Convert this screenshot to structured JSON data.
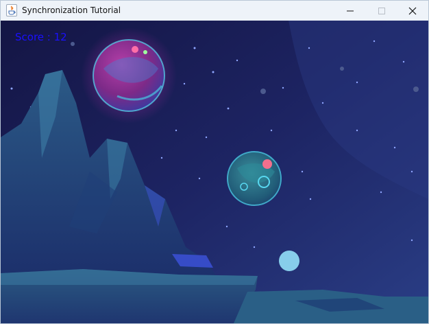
{
  "window": {
    "title": "Synchronization Tutorial",
    "controls": [
      "minimize-icon",
      "maximize-icon",
      "close-icon"
    ]
  },
  "game": {
    "score_text": "Score : 12",
    "score_color": "#1a10ff",
    "ball_color": "#87ceeb",
    "background": "night sky with mountains and planets"
  }
}
